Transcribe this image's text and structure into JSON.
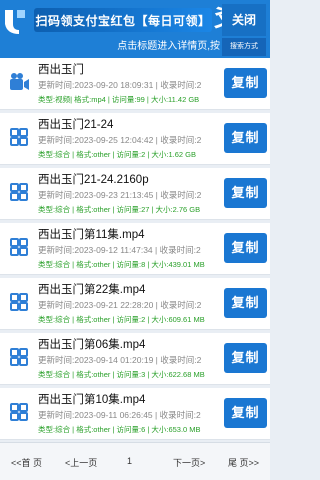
{
  "header": {
    "promo_text": "扫码领支付宝红包【每日可领】",
    "brand_glyph": "爻",
    "close_label": "关闭",
    "marquee_text": "点击标题进入详情页,按",
    "mode_label": "搜索方式"
  },
  "colors": {
    "primary": "#1e7fd6",
    "meta_green": "#2aa02a",
    "copy_button": "#1a77d2"
  },
  "items": [
    {
      "icon": "video-icon",
      "title": "西出玉门",
      "time": "更新时间:2023-09-20 18:09:31 | 收录时间:2",
      "meta": "类型:视频| 格式:mp4 | 访问量:99 | 大小:11.42 GB",
      "copy_label": "复制"
    },
    {
      "icon": "grid-icon",
      "title": "西出玉门21-24",
      "time": "更新时间:2023-09-25 12:04:42 | 收录时间:2",
      "meta": "类型:综合 | 格式:other | 访问量:2 | 大小:1.62 GB",
      "copy_label": "复制"
    },
    {
      "icon": "grid-icon",
      "title": "西出玉门21-24.2160p",
      "time": "更新时间:2023-09-23 21:13:45 | 收录时间:2",
      "meta": "类型:综合 | 格式:other | 访问量:27 | 大小:2.76 GB",
      "copy_label": "复制"
    },
    {
      "icon": "grid-icon",
      "title": "西出玉门第11集.mp4",
      "time": "更新时间:2023-09-12 11:47:34 | 收录时间:2",
      "meta": "类型:综合 | 格式:other | 访问量:8 | 大小:439.01 MB",
      "copy_label": "复制"
    },
    {
      "icon": "grid-icon",
      "title": "西出玉门第22集.mp4",
      "time": "更新时间:2023-09-21 22:28:20 | 收录时间:2",
      "meta": "类型:综合 | 格式:other | 访问量:2 | 大小:609.61 MB",
      "copy_label": "复制"
    },
    {
      "icon": "grid-icon",
      "title": "西出玉门第06集.mp4",
      "time": "更新时间:2023-09-14 01:20:19 | 收录时间:2",
      "meta": "类型:综合 | 格式:other | 访问量:3 | 大小:622.68 MB",
      "copy_label": "复制"
    },
    {
      "icon": "grid-icon",
      "title": "西出玉门第10集.mp4",
      "time": "更新时间:2023-09-11 06:26:45 | 收录时间:2",
      "meta": "类型:综合 | 格式:other | 访问量:6 | 大小:653.0 MB",
      "copy_label": "复制"
    }
  ],
  "pager": {
    "first": "<<首 页",
    "prev": "<上一页",
    "current": "1",
    "next": "下一页>",
    "last": "尾 页>>"
  }
}
